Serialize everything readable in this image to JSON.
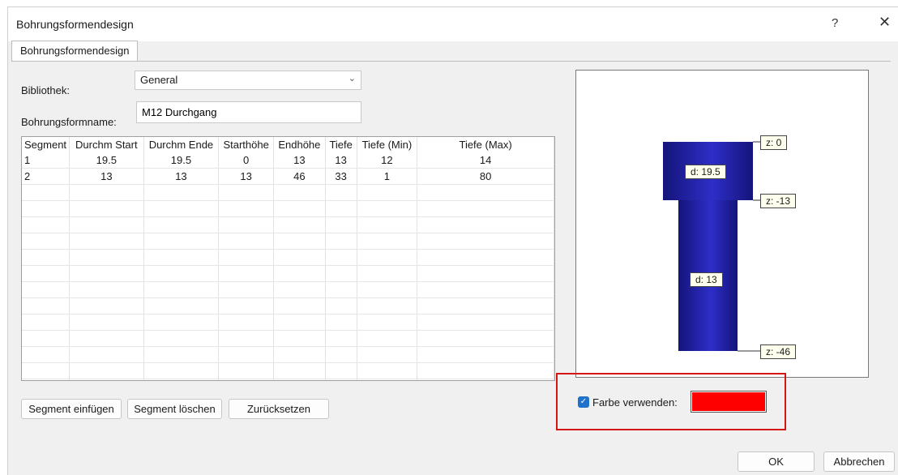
{
  "window": {
    "title": "Bohrungsformendesign",
    "help_glyph": "?",
    "close_glyph": "✕"
  },
  "tab": {
    "label": "Bohrungsformendesign"
  },
  "form": {
    "library_label": "Bibliothek:",
    "library_value": "General",
    "name_label": "Bohrungsformname:",
    "name_value": "M12 Durchgang"
  },
  "table": {
    "columns": [
      "Segment",
      "Durchm Start",
      "Durchm Ende",
      "Starthöhe",
      "Endhöhe",
      "Tiefe",
      "Tiefe (Min)",
      "Tiefe (Max)"
    ],
    "rows": [
      [
        "1",
        "19.5",
        "19.5",
        "0",
        "13",
        "13",
        "12",
        "14"
      ],
      [
        "2",
        "13",
        "13",
        "13",
        "46",
        "33",
        "1",
        "80"
      ]
    ]
  },
  "buttons": {
    "insert": "Segment einfügen",
    "delete": "Segment löschen",
    "reset": "Zurücksetzen",
    "ok": "OK",
    "cancel": "Abbrechen"
  },
  "preview": {
    "z_labels": [
      "z: 0",
      "z: -13",
      "z: -46"
    ],
    "d_labels": [
      "d: 19.5",
      "d: 13"
    ],
    "hole_color": "#1e1e96"
  },
  "color_option": {
    "label": "Farbe verwenden:",
    "checked": true,
    "color": "#ff0000"
  },
  "highlight_color": "#d51414"
}
